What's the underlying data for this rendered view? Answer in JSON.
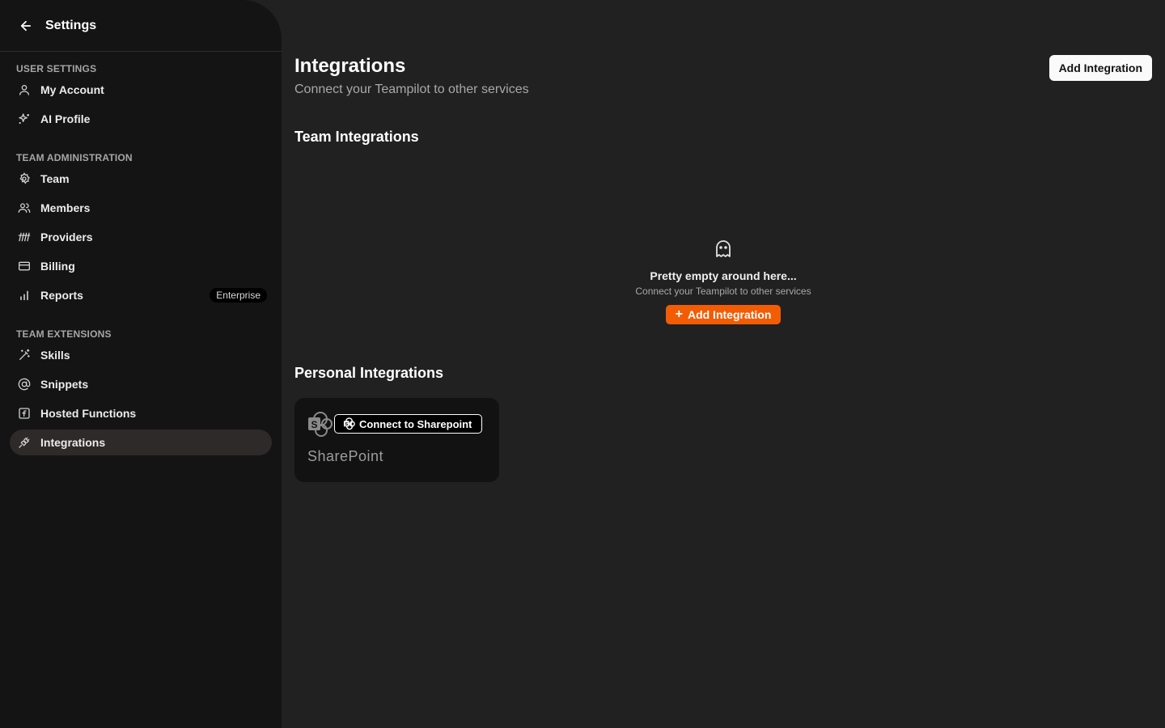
{
  "sidebar": {
    "title": "Settings",
    "groups": [
      {
        "label": "User Settings",
        "items": [
          {
            "label": "My Account",
            "icon": "user-icon"
          },
          {
            "label": "AI Profile",
            "icon": "sparkles-icon"
          }
        ]
      },
      {
        "label": "Team Administration",
        "items": [
          {
            "label": "Team",
            "icon": "gear-icon"
          },
          {
            "label": "Members",
            "icon": "users-icon"
          },
          {
            "label": "Providers",
            "icon": "providers-icon"
          },
          {
            "label": "Billing",
            "icon": "credit-card-icon"
          },
          {
            "label": "Reports",
            "icon": "bar-chart-icon",
            "badge": "Enterprise"
          }
        ]
      },
      {
        "label": "Team Extensions",
        "items": [
          {
            "label": "Skills",
            "icon": "magic-wand-icon"
          },
          {
            "label": "Snippets",
            "icon": "at-sign-icon"
          },
          {
            "label": "Hosted Functions",
            "icon": "function-icon"
          },
          {
            "label": "Integrations",
            "icon": "plug-icon",
            "active": true
          }
        ]
      }
    ]
  },
  "main": {
    "title": "Integrations",
    "subtitle": "Connect your Teampilot to other services",
    "add_button": "Add Integration",
    "team_section": {
      "heading": "Team Integrations",
      "empty_icon": "ghost-icon",
      "empty_title": "Pretty empty around here...",
      "empty_subtitle": "Connect your Teampilot to other services",
      "empty_button": "Add Integration"
    },
    "personal_section": {
      "heading": "Personal Integrations",
      "cards": [
        {
          "name": "SharePoint",
          "logo": "sharepoint-icon",
          "button": "Connect to Sharepoint"
        }
      ]
    }
  },
  "colors": {
    "background": "#212121",
    "sidebar": "#141414",
    "accent": "#f25c05",
    "active_item": "#2e2a29"
  }
}
